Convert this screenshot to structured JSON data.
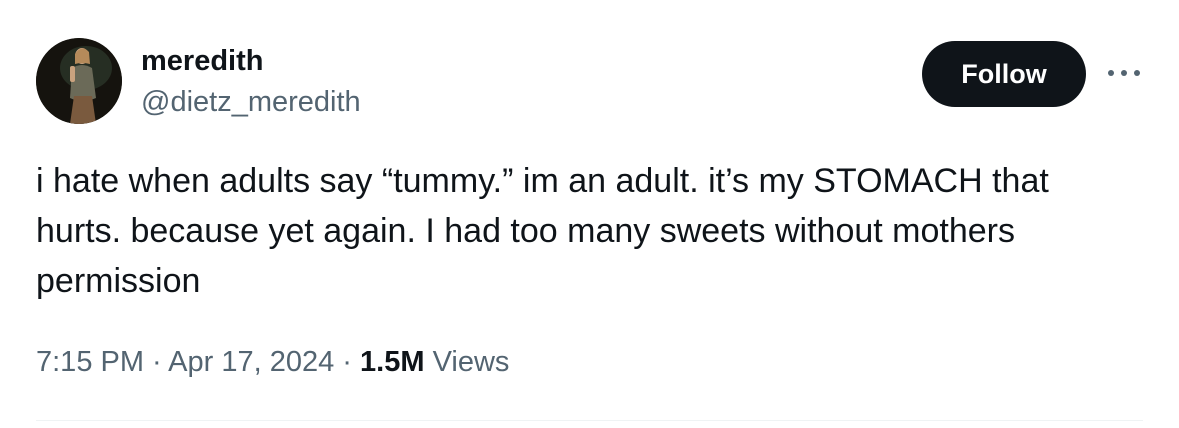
{
  "user": {
    "display_name": "meredith",
    "handle": "@dietz_meredith",
    "avatar_icon": "profile-photo"
  },
  "actions": {
    "follow_label": "Follow",
    "more_icon": "more-horizontal-icon"
  },
  "tweet": {
    "text": "i hate when adults say “tummy.” im an adult. it’s my STOMACH that\nhurts. because yet again. I had too many sweets without mothers\npermission"
  },
  "meta": {
    "time": "7:15 PM",
    "separator1": " · ",
    "date": "Apr 17, 2024",
    "separator2": " · ",
    "views_count": "1.5M",
    "views_label": " Views"
  },
  "colors": {
    "text_primary": "#0f1419",
    "text_secondary": "#536471",
    "button_bg": "#0f1419",
    "button_text": "#ffffff",
    "divider": "#eff3f4"
  }
}
